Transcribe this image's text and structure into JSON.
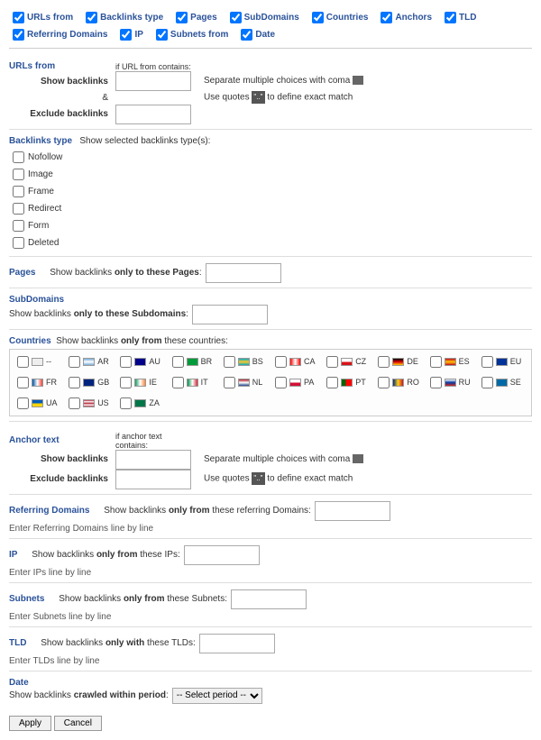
{
  "topFilters": [
    {
      "label": "URLs from"
    },
    {
      "label": "Backlinks type"
    },
    {
      "label": "Pages"
    },
    {
      "label": "SubDomains"
    },
    {
      "label": "Countries"
    },
    {
      "label": "Anchors"
    },
    {
      "label": "TLD"
    },
    {
      "label": "Referring Domains"
    },
    {
      "label": "IP"
    },
    {
      "label": "Subnets from"
    },
    {
      "label": "Date"
    }
  ],
  "urlsFrom": {
    "title": "URLs from",
    "ifContains": "if URL from contains:",
    "show": "Show backlinks",
    "amp": "&",
    "exclude": "Exclude backlinks",
    "hint1": "Separate multiple choices with coma",
    "hint2_pre": "Use quotes ",
    "hint2_quote": "\"..\"",
    "hint2_post": " to define exact match"
  },
  "backlinksType": {
    "title": "Backlinks type",
    "desc": "Show selected backlinks type(s):",
    "items": [
      "Nofollow",
      "Image",
      "Frame",
      "Redirect",
      "Form",
      "Deleted"
    ]
  },
  "pages": {
    "title": "Pages",
    "desc_pre": "Show backlinks ",
    "desc_bold": "only to these Pages",
    "desc_post": ":"
  },
  "subdomains": {
    "title": "SubDomains",
    "desc_pre": "Show backlinks ",
    "desc_bold": "only to these Subdomains",
    "desc_post": ":"
  },
  "countries": {
    "title": "Countries",
    "desc_pre": "Show backlinks ",
    "desc_bold": "only from",
    "desc_post": " these countries:",
    "list": [
      {
        "code": "--",
        "bg": "#eee"
      },
      {
        "code": "AR",
        "bg": "linear-gradient(#75aadb,#fff,#75aadb)"
      },
      {
        "code": "AU",
        "bg": "#00008b"
      },
      {
        "code": "BR",
        "bg": "#009b3a"
      },
      {
        "code": "BS",
        "bg": "linear-gradient(#00abc9,#ffc726,#00abc9)"
      },
      {
        "code": "CA",
        "bg": "linear-gradient(90deg,#f00,#fff,#f00)"
      },
      {
        "code": "CZ",
        "bg": "linear-gradient(#fff 50%,#d7141a 50%)"
      },
      {
        "code": "DE",
        "bg": "linear-gradient(#000,#dd0000,#ffce00)"
      },
      {
        "code": "ES",
        "bg": "linear-gradient(#c60b1e,#ffc400,#c60b1e)"
      },
      {
        "code": "EU",
        "bg": "#003399"
      },
      {
        "code": "FR",
        "bg": "linear-gradient(90deg,#0055a4,#fff,#ef4135)"
      },
      {
        "code": "GB",
        "bg": "#00247d"
      },
      {
        "code": "IE",
        "bg": "linear-gradient(90deg,#169b62,#fff,#ff883e)"
      },
      {
        "code": "IT",
        "bg": "linear-gradient(90deg,#009246,#fff,#ce2b37)"
      },
      {
        "code": "NL",
        "bg": "linear-gradient(#ae1c28,#fff,#21468b)"
      },
      {
        "code": "PA",
        "bg": "linear-gradient(#fff 50%,#d21034 50%)"
      },
      {
        "code": "PT",
        "bg": "linear-gradient(90deg,#060 40%,#f00 40%)"
      },
      {
        "code": "RO",
        "bg": "linear-gradient(90deg,#002b7f,#fcd116,#ce1126)"
      },
      {
        "code": "RU",
        "bg": "linear-gradient(#fff,#0039a6,#d52b1e)"
      },
      {
        "code": "SE",
        "bg": "#006aa7"
      },
      {
        "code": "UA",
        "bg": "linear-gradient(#005bbb 50%,#ffd500 50%)"
      },
      {
        "code": "US",
        "bg": "linear-gradient(#b22234,#fff,#b22234,#fff,#b22234)"
      },
      {
        "code": "ZA",
        "bg": "#007749"
      }
    ]
  },
  "anchor": {
    "title": "Anchor text",
    "ifContains": "if anchor text contains:",
    "show": "Show backlinks",
    "exclude": "Exclude backlinks",
    "hint1": "Separate multiple choices with coma",
    "hint2_pre": "Use quotes ",
    "hint2_quote": "\"..\"",
    "hint2_post": " to define exact match"
  },
  "refDomains": {
    "title": "Referring Domains",
    "desc_pre": "Show backlinks ",
    "desc_bold": "only from",
    "desc_post": " these referring Domains:",
    "helper": "Enter Referring Domains line by line"
  },
  "ip": {
    "title": "IP",
    "desc_pre": "Show backlinks ",
    "desc_bold": "only from",
    "desc_post": " these IPs:",
    "helper": "Enter IPs line by line"
  },
  "subnets": {
    "title": "Subnets",
    "desc_pre": "Show backlinks ",
    "desc_bold": "only from",
    "desc_post": " these Subnets:",
    "helper": "Enter Subnets line by line"
  },
  "tld": {
    "title": "TLD",
    "desc_pre": "Show backlinks ",
    "desc_bold": "only with",
    "desc_post": " these TLDs:",
    "helper": "Enter TLDs line by line"
  },
  "date": {
    "title": "Date",
    "desc_pre": "Show backlinks ",
    "desc_bold": "crawled within period",
    "desc_post": ":",
    "selected": "-- Select period --"
  },
  "buttons": {
    "apply": "Apply",
    "cancel": "Cancel"
  }
}
